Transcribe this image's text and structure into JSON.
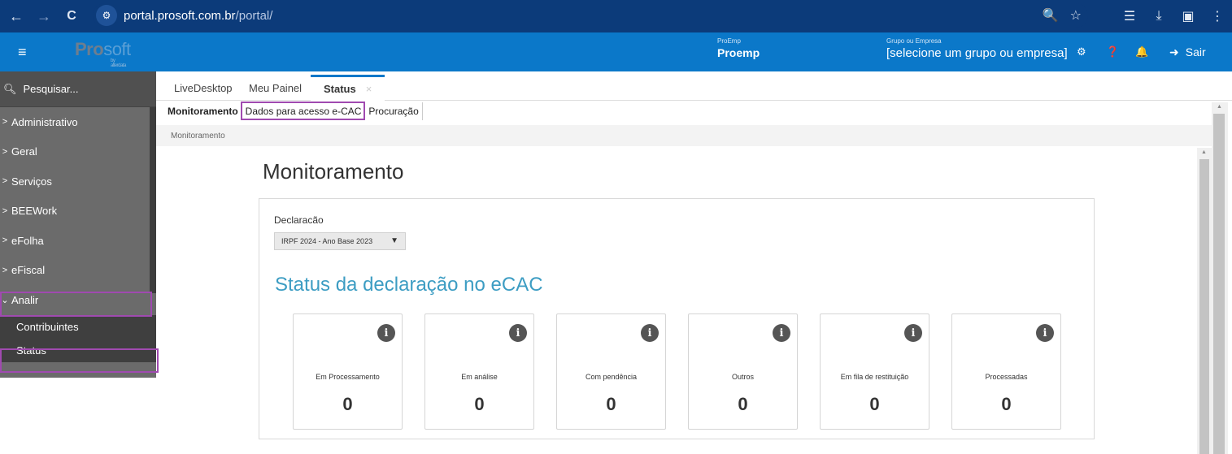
{
  "browser": {
    "url_host": "portal.prosoft.com.br",
    "url_path": "/portal/",
    "back": "←",
    "forward": "→",
    "reload": "C"
  },
  "header": {
    "menu_icon": "≡",
    "logo_pro": "Pro",
    "logo_soft": "soft",
    "logo_sub": "by alterdata",
    "proemp_label": "ProEmp",
    "proemp_value": "Proemp",
    "grupo_label": "Grupo ou Empresa",
    "grupo_value": "[selecione um grupo ou empresa]",
    "sair": "Sair"
  },
  "sidebar": {
    "search_placeholder": "Pesquisar...",
    "items": [
      {
        "label": "Administrativo",
        "chevron": ">"
      },
      {
        "label": "Geral",
        "chevron": ">"
      },
      {
        "label": "Serviços",
        "chevron": ">"
      },
      {
        "label": "BEEWork",
        "chevron": ">"
      },
      {
        "label": "eFolha",
        "chevron": ">"
      },
      {
        "label": "eFiscal",
        "chevron": ">"
      },
      {
        "label": "Analir",
        "chevron": "⌄"
      }
    ],
    "subitems": [
      {
        "label": "Contribuintes"
      },
      {
        "label": "Status"
      }
    ]
  },
  "tabs": [
    {
      "label": "LiveDesktop"
    },
    {
      "label": "Meu Painel"
    },
    {
      "label": "Status",
      "close": "×"
    }
  ],
  "subtabs": [
    {
      "label": "Monitoramento"
    },
    {
      "label": "Dados para acesso e-CAC"
    },
    {
      "label": "Procuração"
    }
  ],
  "breadcrumb": "Monitoramento",
  "main": {
    "title": "Monitoramento",
    "declaracao_label": "Declaracão",
    "declaracao_value": "IRPF 2024 - Ano Base 2023",
    "status_title": "Status da declaração no eCAC",
    "cards": [
      {
        "label": "Em Processamento",
        "value": "0"
      },
      {
        "label": "Em análise",
        "value": "0"
      },
      {
        "label": "Com pendência",
        "value": "0"
      },
      {
        "label": "Outros",
        "value": "0"
      },
      {
        "label": "Em fila de restituição",
        "value": "0"
      },
      {
        "label": "Processadas",
        "value": "0"
      }
    ]
  }
}
